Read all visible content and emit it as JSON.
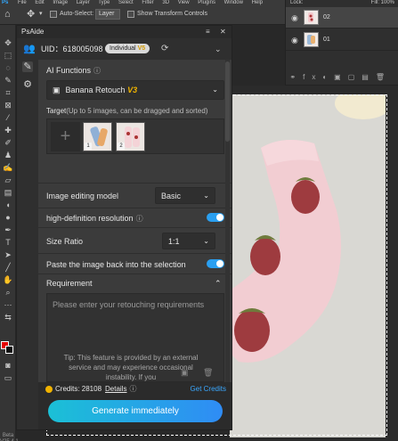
{
  "photoshop": {
    "menu_items": [
      "File",
      "Edit",
      "Image",
      "Layer",
      "Type",
      "Select",
      "Filter",
      "3D",
      "View",
      "Plugins",
      "Window",
      "Help"
    ],
    "options": {
      "auto_select_label": "Auto-Select:",
      "auto_select_value": "Layer",
      "transform_label": "Show Transform Controls"
    },
    "layers": {
      "lock_label": "Lock:",
      "fill_label": "Fill: 100%",
      "items": [
        {
          "name": "02"
        },
        {
          "name": "01"
        }
      ]
    },
    "tools_footer": "Beta V25.4.1"
  },
  "panel": {
    "title": "PsAide",
    "uid_label": "UID：618005098",
    "badge_label": "Individual",
    "badge_version": "V5",
    "ai_functions_label": "AI Functions",
    "function_prefix": "Banana Retouch",
    "function_version": "V3",
    "target_label": "Target",
    "target_hint": "(Up to 5 images, can be dragged and sorted)",
    "target_images": [
      {
        "index": "1"
      },
      {
        "index": "2"
      }
    ],
    "model_label": "Image editing model",
    "model_value": "Basic",
    "hd_label": "high-definition resolution",
    "hd_enabled": true,
    "size_ratio_label": "Size Ratio",
    "size_ratio_value": "1:1",
    "paste_back_label": "Paste the image back into the selection",
    "paste_back_enabled": true,
    "requirement_label": "Requirement",
    "requirement_placeholder": "Please enter your retouching requirements",
    "tip_text": "Tip: This feature is provided by an external service and may experience occasional instability. If you",
    "credits_label": "Credits: 28108",
    "details_label": "Details",
    "get_credits_label": "Get Credits",
    "generate_label": "Generate immediately"
  },
  "colors": {
    "accent": "#2a9ff0",
    "version_gold": "#f0b400",
    "foreground": "#e30000",
    "background": "#111111"
  }
}
